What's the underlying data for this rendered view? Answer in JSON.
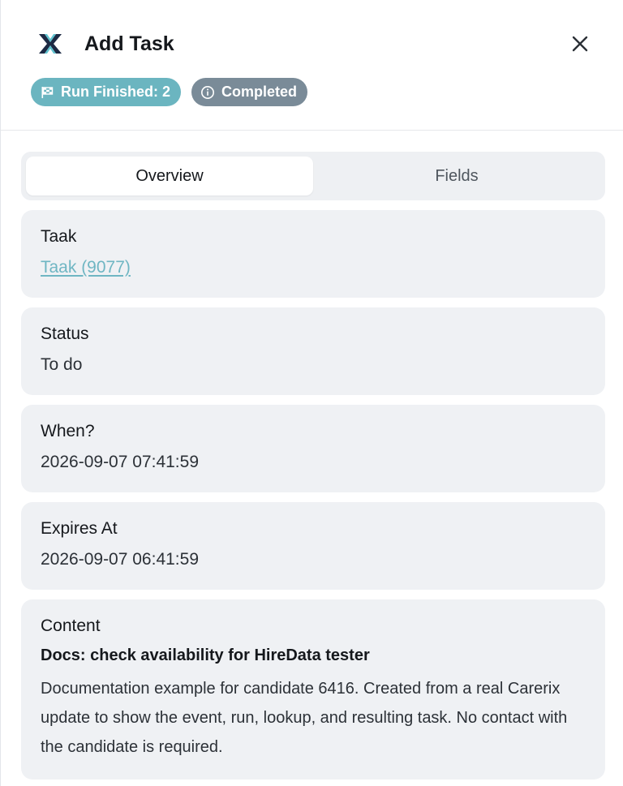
{
  "header": {
    "title": "Add Task",
    "logo_icon": "brand-x-logo-icon",
    "close_icon": "close-icon",
    "badges": [
      {
        "label": "Run Finished: 2",
        "icon": "flag-icon",
        "color": "#6bb5c0"
      },
      {
        "label": "Completed",
        "icon": "info-icon",
        "color": "#7a8b98"
      }
    ]
  },
  "tabs": [
    {
      "label": "Overview",
      "active": true
    },
    {
      "label": "Fields",
      "active": false
    }
  ],
  "fields": {
    "taak": {
      "label": "Taak",
      "value": "Taak (9077)"
    },
    "status": {
      "label": "Status",
      "value": "To do"
    },
    "when": {
      "label": "When?",
      "value": "2026-09-07 07:41:59"
    },
    "expires": {
      "label": "Expires At",
      "value": "2026-09-07 06:41:59"
    },
    "content": {
      "label": "Content",
      "subject": "Docs: check availability for HireData tester",
      "body": "Documentation example for candidate 6416. Created from a real Carerix update to show the event, run, lookup, and resulting task. No contact with the candidate is required."
    }
  }
}
